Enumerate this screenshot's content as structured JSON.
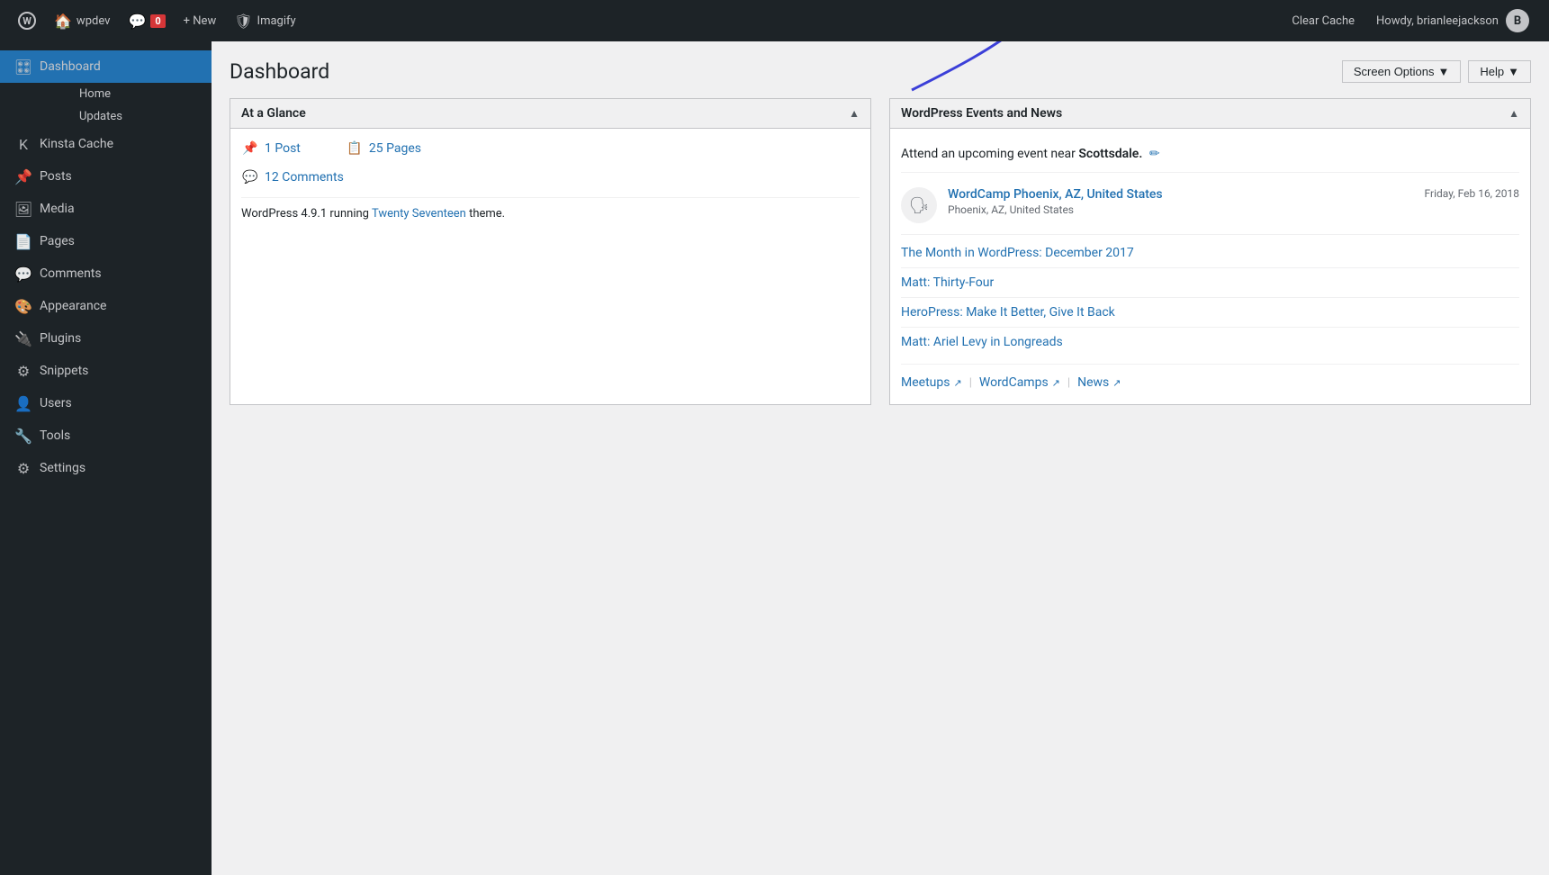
{
  "adminBar": {
    "wpLogo": "W",
    "siteName": "wpdev",
    "commentsLabel": "Comments",
    "commentsCount": "0",
    "newLabel": "+ New",
    "pluginLabel": "Imagify",
    "clearCacheLabel": "Clear Cache",
    "howdyText": "Howdy, brianleejackson"
  },
  "sidebar": {
    "dashboardLabel": "Dashboard",
    "homeLabel": "Home",
    "updatesLabel": "Updates",
    "kinstaCacheLabel": "Kinsta Cache",
    "postsLabel": "Posts",
    "mediaLabel": "Media",
    "pagesLabel": "Pages",
    "commentsLabel": "Comments",
    "appearanceLabel": "Appearance",
    "pluginsLabel": "Plugins",
    "snippetsLabel": "Snippets",
    "usersLabel": "Users",
    "toolsLabel": "Tools",
    "settingsLabel": "Settings"
  },
  "header": {
    "title": "Dashboard",
    "screenOptionsLabel": "Screen Options",
    "helpLabel": "Help"
  },
  "atAGlance": {
    "title": "At a Glance",
    "postCount": "1 Post",
    "pagesCount": "25 Pages",
    "commentsCount": "12 Comments",
    "wpVersion": "WordPress 4.9.1 running ",
    "themeName": "Twenty Seventeen",
    "themeText": " theme."
  },
  "wpEvents": {
    "title": "WordPress Events and News",
    "attendText": "Attend an upcoming event near ",
    "city": "Scottsdale.",
    "event": {
      "title": "WordCamp Phoenix, AZ, United States",
      "location": "Phoenix, AZ, United States",
      "date": "Friday, Feb 16, 2018"
    },
    "newsItems": [
      "The Month in WordPress: December 2017",
      "Matt: Thirty-Four",
      "HeroPress: Make It Better, Give It Back",
      "Matt: Ariel Levy in Longreads"
    ],
    "footerLinks": [
      "Meetups",
      "WordCamps",
      "News"
    ]
  },
  "colors": {
    "adminBarBg": "#1d2327",
    "sidebarBg": "#1d2327",
    "activeBlue": "#2271b1",
    "dashboardActiveBg": "#2271b1"
  }
}
